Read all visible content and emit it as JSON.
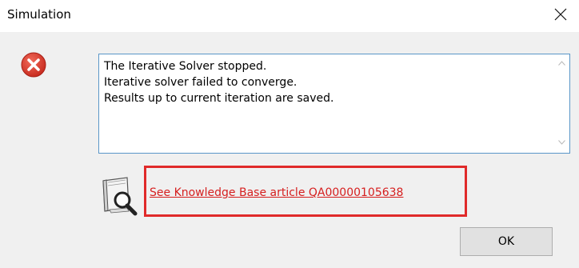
{
  "window": {
    "title": "Simulation",
    "close_icon": "close-icon"
  },
  "message": {
    "icon": "error-icon",
    "lines": [
      "The Iterative Solver stopped.",
      "Iterative solver failed to converge.",
      "Results up to current iteration are saved."
    ]
  },
  "knowledge_base": {
    "icon": "knowledge-base-search-icon",
    "link_text": "See Knowledge Base article QA00000105638"
  },
  "buttons": {
    "ok_label": "OK"
  },
  "colors": {
    "accent_red": "#e02a2a",
    "link_red": "#d61f1f",
    "textbox_border": "#5a96c8"
  }
}
